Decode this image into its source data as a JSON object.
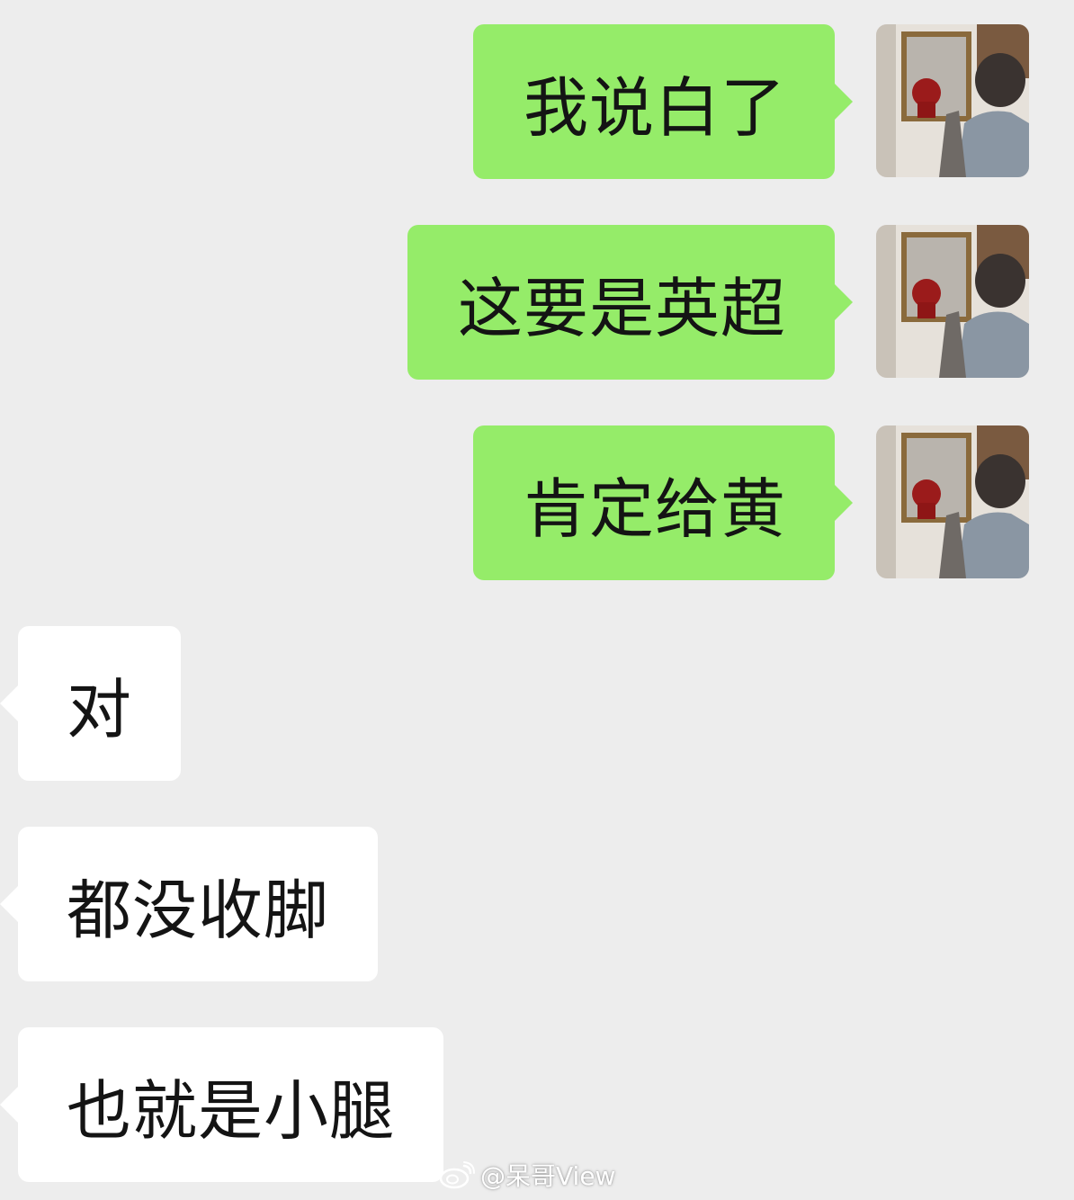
{
  "messages": [
    {
      "side": "out",
      "text": "我说白了"
    },
    {
      "side": "out",
      "text": "这要是英超"
    },
    {
      "side": "out",
      "text": "肯定给黄"
    },
    {
      "side": "in",
      "text": "对"
    },
    {
      "side": "in",
      "text": "都没收脚"
    },
    {
      "side": "in",
      "text": "也就是小腿"
    }
  ],
  "watermark": {
    "text": "@呆哥View",
    "icon": "weibo-icon"
  },
  "colors": {
    "background": "#ededed",
    "outgoing_bubble": "#95ec69",
    "incoming_bubble": "#ffffff"
  }
}
